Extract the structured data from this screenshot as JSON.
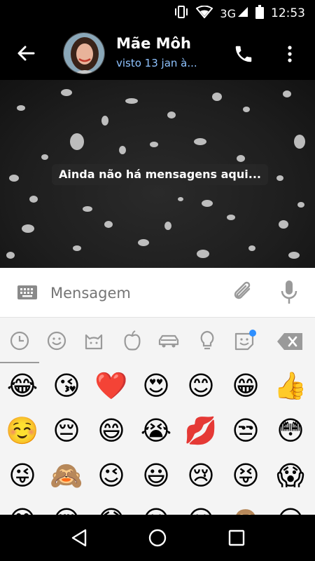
{
  "status_bar": {
    "network": "3G",
    "time": "12:53"
  },
  "header": {
    "contact_name": "Mãe Môh",
    "last_seen": "visto 13 jan à..."
  },
  "chat": {
    "empty_message": "Ainda não há mensagens aqui..."
  },
  "composer": {
    "placeholder": "Mensagem"
  },
  "emoji_panel": {
    "tabs": [
      "recent-icon",
      "smiley-icon",
      "cat-icon",
      "apple-icon",
      "car-icon",
      "lightbulb-icon",
      "sticker-icon"
    ],
    "emojis": [
      "😂",
      "😘",
      "❤️",
      "😍",
      "😊",
      "😁",
      "👍",
      "☺️",
      "😔",
      "😄",
      "😭",
      "💋",
      "😒",
      "😳",
      "😜",
      "🙈",
      "😉",
      "😃",
      "😢",
      "😝",
      "😱",
      "😅",
      "😌",
      "😓",
      "😐",
      "😕",
      "🙊",
      "😏"
    ]
  },
  "colors": {
    "status_link": "#8fc3ff",
    "badge": "#2e8fff",
    "icon_gray": "#9a9a9a"
  }
}
